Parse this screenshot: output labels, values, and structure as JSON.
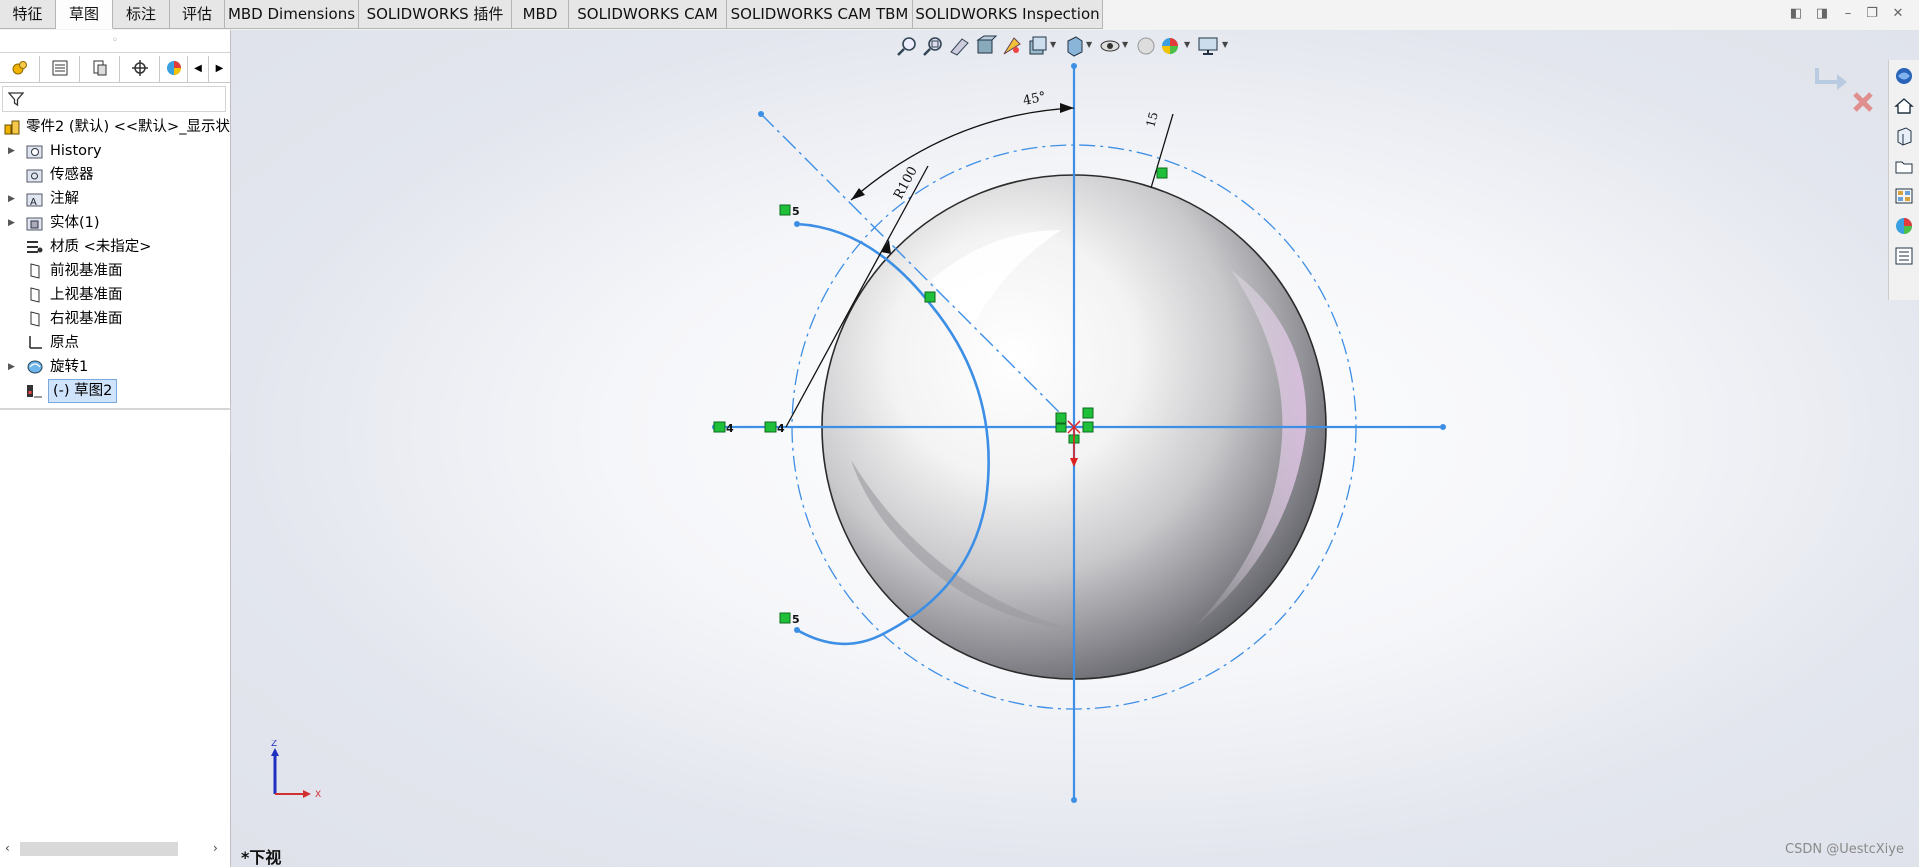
{
  "tabs": [
    {
      "label": "特征",
      "active": false
    },
    {
      "label": "草图",
      "active": true
    },
    {
      "label": "标注",
      "active": false
    },
    {
      "label": "评估",
      "active": false
    },
    {
      "label": "MBD Dimensions",
      "active": false
    },
    {
      "label": "SOLIDWORKS 插件",
      "active": false
    },
    {
      "label": "MBD",
      "active": false
    },
    {
      "label": "SOLIDWORKS CAM",
      "active": false
    },
    {
      "label": "SOLIDWORKS CAM TBM",
      "active": false
    },
    {
      "label": "SOLIDWORKS Inspection",
      "active": false
    }
  ],
  "tree": {
    "root": "零件2 (默认) <<默认>_显示状",
    "items": [
      {
        "label": "History",
        "expandable": true,
        "icon": "history-folder-icon"
      },
      {
        "label": "传感器",
        "expandable": false,
        "icon": "sensor-icon"
      },
      {
        "label": "注解",
        "expandable": true,
        "icon": "annotation-icon"
      },
      {
        "label": "实体(1)",
        "expandable": true,
        "icon": "solid-body-icon"
      },
      {
        "label": "材质 <未指定>",
        "expandable": false,
        "icon": "material-icon"
      },
      {
        "label": "前视基准面",
        "expandable": false,
        "icon": "plane-icon"
      },
      {
        "label": "上视基准面",
        "expandable": false,
        "icon": "plane-icon"
      },
      {
        "label": "右视基准面",
        "expandable": false,
        "icon": "plane-icon"
      },
      {
        "label": "原点",
        "expandable": false,
        "icon": "origin-icon"
      },
      {
        "label": "旋转1",
        "expandable": true,
        "icon": "revolve-icon"
      },
      {
        "label": "(-) 草图2",
        "expandable": false,
        "icon": "sketch-icon",
        "selected": true
      }
    ]
  },
  "viewport": {
    "view_name": "*下视",
    "watermark": "CSDN @UestcXiye",
    "dimensions": {
      "angle": "45°",
      "radius": "R100",
      "offset": "15"
    },
    "relation_numbers": [
      "5",
      "5",
      "4",
      "4"
    ],
    "triad": {
      "z": "Z",
      "x": "X"
    },
    "colors": {
      "sketch_line": "#3d8fe6",
      "dimension": "#000000",
      "relation_badge": "#1fbf3a",
      "triad_z": "#1f2fbf",
      "triad_x": "#d23030"
    }
  }
}
